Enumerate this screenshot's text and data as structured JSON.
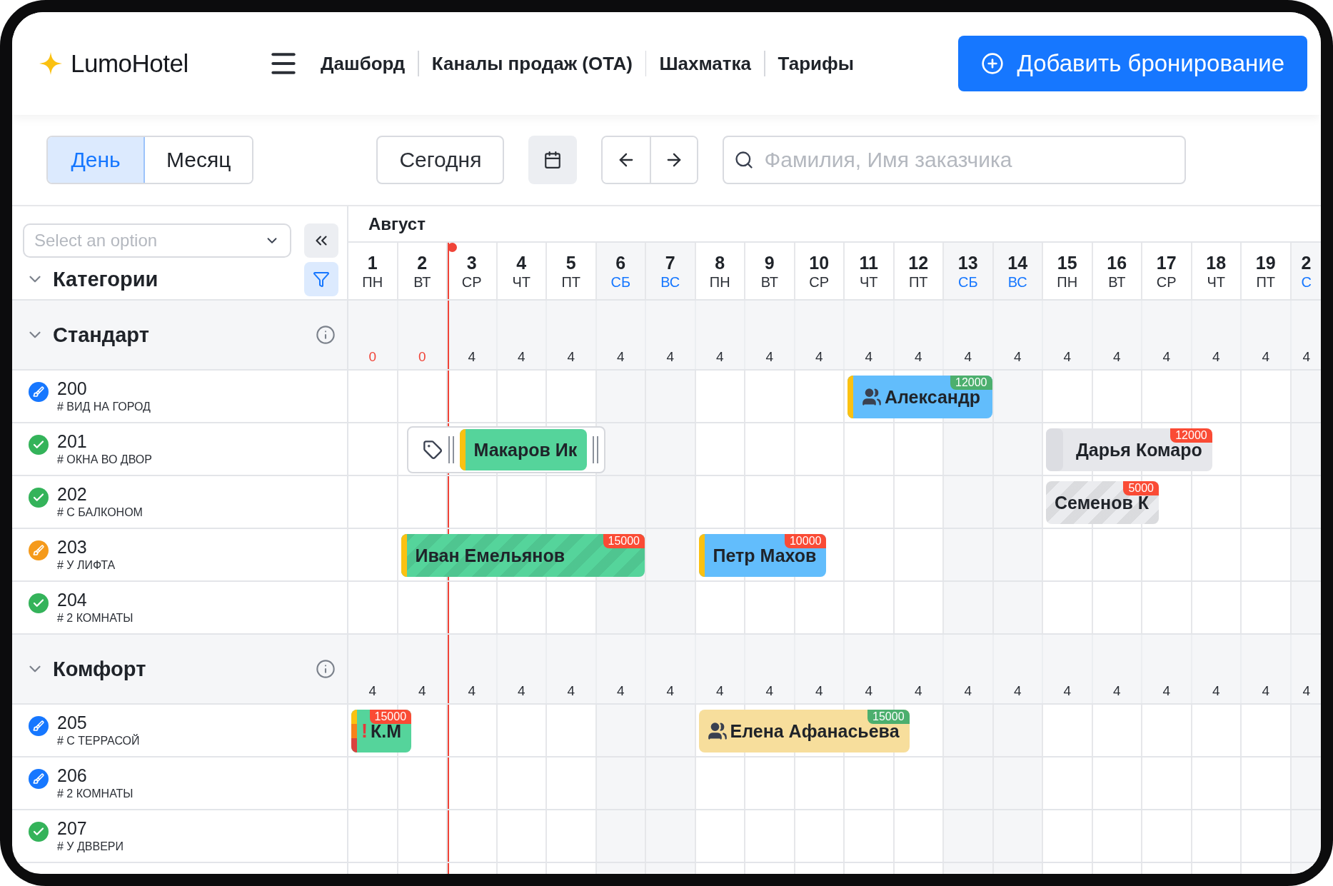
{
  "header": {
    "logo": "LumoHotel",
    "nav": [
      {
        "label": "Дашборд",
        "selected": false
      },
      {
        "label": "Каналы продаж (ОТА)",
        "selected": false
      },
      {
        "label": "Шахматка",
        "selected": false
      },
      {
        "label": "Тарифы",
        "selected": false
      }
    ],
    "add_button": "Добавить бронирование"
  },
  "toolbar": {
    "views": [
      {
        "label": "День",
        "selected": true
      },
      {
        "label": "Месяц",
        "selected": false
      }
    ],
    "today_button": "Сегодня",
    "search": {
      "placeholder": "Фамилия, Имя заказчика"
    }
  },
  "sidebar": {
    "select": {
      "placeholder": "Select an option"
    },
    "categories_title": "Категории",
    "categories_expanded": true
  },
  "calendar": {
    "month": "Август",
    "days": [
      {
        "num": "1",
        "name": "ПН",
        "weekend": false,
        "today": false
      },
      {
        "num": "2",
        "name": "ВТ",
        "weekend": false,
        "today": false
      },
      {
        "num": "3",
        "name": "СР",
        "weekend": false,
        "today": true
      },
      {
        "num": "4",
        "name": "ЧТ",
        "weekend": false,
        "today": false
      },
      {
        "num": "5",
        "name": "ПТ",
        "weekend": false,
        "today": false
      },
      {
        "num": "6",
        "name": "СБ",
        "weekend": true,
        "today": false
      },
      {
        "num": "7",
        "name": "ВС",
        "weekend": true,
        "today": false
      },
      {
        "num": "8",
        "name": "ПН",
        "weekend": false,
        "today": false
      },
      {
        "num": "9",
        "name": "ВТ",
        "weekend": false,
        "today": false
      },
      {
        "num": "10",
        "name": "СР",
        "weekend": false,
        "today": false
      },
      {
        "num": "11",
        "name": "ЧТ",
        "weekend": false,
        "today": false
      },
      {
        "num": "12",
        "name": "ПТ",
        "weekend": false,
        "today": false
      },
      {
        "num": "13",
        "name": "СБ",
        "weekend": true,
        "today": false
      },
      {
        "num": "14",
        "name": "ВС",
        "weekend": true,
        "today": false
      },
      {
        "num": "15",
        "name": "ПН",
        "weekend": false,
        "today": false
      },
      {
        "num": "16",
        "name": "ВТ",
        "weekend": false,
        "today": false
      },
      {
        "num": "17",
        "name": "СР",
        "weekend": false,
        "today": false
      },
      {
        "num": "18",
        "name": "ЧТ",
        "weekend": false,
        "today": false
      },
      {
        "num": "19",
        "name": "ПТ",
        "weekend": false,
        "today": false
      },
      {
        "num": "2",
        "name": "С",
        "weekend": true,
        "today": false
      }
    ]
  },
  "categories": [
    {
      "name": "Стандарт",
      "expanded": true,
      "counts": [
        {
          "value": "0",
          "sold_out": true
        },
        {
          "value": "0",
          "sold_out": true
        },
        {
          "value": "4",
          "sold_out": false
        },
        {
          "value": "4",
          "sold_out": false
        },
        {
          "value": "4",
          "sold_out": false
        },
        {
          "value": "4",
          "sold_out": false
        },
        {
          "value": "4",
          "sold_out": false
        },
        {
          "value": "4",
          "sold_out": false
        },
        {
          "value": "4",
          "sold_out": false
        },
        {
          "value": "4",
          "sold_out": false
        },
        {
          "value": "4",
          "sold_out": false
        },
        {
          "value": "4",
          "sold_out": false
        },
        {
          "value": "4",
          "sold_out": false
        },
        {
          "value": "4",
          "sold_out": false
        },
        {
          "value": "4",
          "sold_out": false
        },
        {
          "value": "4",
          "sold_out": false
        },
        {
          "value": "4",
          "sold_out": false
        },
        {
          "value": "4",
          "sold_out": false
        },
        {
          "value": "4",
          "sold_out": false
        },
        {
          "value": "4",
          "sold_out": false
        }
      ],
      "rooms": [
        {
          "number": "200",
          "tag": "# ВИД НА ГОРОД",
          "kind": "cleaning",
          "bookings": [
            {
              "guest": "Александр",
              "kind": "marked",
              "color": "#62bdfc",
              "striped": false,
              "group": true,
              "selected": false,
              "badge": {
                "text": "12000",
                "color": "#4caf6e"
              }
            }
          ]
        },
        {
          "number": "201",
          "tag": "# ОКНА ВО ДВОР",
          "kind": "clean",
          "bookings": [
            {
              "guest": "Макаров Ик",
              "kind": "marked",
              "color": "#55d49b",
              "striped": false,
              "group": false,
              "selected": true
            },
            {
              "guest": "Дарья Комаро",
              "kind": "split",
              "color": "#e6e7eb",
              "striped": false,
              "group": false,
              "selected": false,
              "badge": {
                "text": "12000",
                "color": "#fa4b35"
              }
            }
          ]
        },
        {
          "number": "202",
          "tag": "# С БАЛКОНОМ",
          "kind": "clean",
          "bookings": [
            {
              "guest": "Семенов К",
              "kind": "plain",
              "color": "#ebecef",
              "striped": true,
              "group": false,
              "selected": false,
              "badge": {
                "text": "5000",
                "color": "#fa4b35"
              }
            }
          ]
        },
        {
          "number": "203",
          "tag": "# У ЛИФТА",
          "kind": "dirty",
          "bookings": [
            {
              "guest": "Иван Емельянов",
              "kind": "marked",
              "color": "#55d49b",
              "striped": true,
              "group": false,
              "selected": false,
              "badge": {
                "text": "15000",
                "color": "#fa4b35"
              }
            },
            {
              "guest": "Петр Махов",
              "kind": "marked",
              "color": "#62bdfc",
              "striped": false,
              "group": false,
              "selected": false,
              "badge": {
                "text": "10000",
                "color": "#fa4b35"
              }
            }
          ]
        },
        {
          "number": "204",
          "tag": "# 2 КОМНАТЫ",
          "kind": "clean"
        }
      ]
    },
    {
      "name": "Комфорт",
      "expanded": true,
      "counts": [
        {
          "value": "4",
          "sold_out": false
        },
        {
          "value": "4",
          "sold_out": false
        },
        {
          "value": "4",
          "sold_out": false
        },
        {
          "value": "4",
          "sold_out": false
        },
        {
          "value": "4",
          "sold_out": false
        },
        {
          "value": "4",
          "sold_out": false
        },
        {
          "value": "4",
          "sold_out": false
        },
        {
          "value": "4",
          "sold_out": false
        },
        {
          "value": "4",
          "sold_out": false
        },
        {
          "value": "4",
          "sold_out": false
        },
        {
          "value": "4",
          "sold_out": false
        },
        {
          "value": "4",
          "sold_out": false
        },
        {
          "value": "4",
          "sold_out": false
        },
        {
          "value": "4",
          "sold_out": false
        },
        {
          "value": "4",
          "sold_out": false
        },
        {
          "value": "4",
          "sold_out": false
        },
        {
          "value": "4",
          "sold_out": false
        },
        {
          "value": "4",
          "sold_out": false
        },
        {
          "value": "4",
          "sold_out": false
        },
        {
          "value": "4",
          "sold_out": false
        }
      ],
      "rooms": [
        {
          "number": "205",
          "tag": "# С ТЕРРАСОЙ",
          "kind": "cleaning",
          "bookings": [
            {
              "guest": "К.М",
              "alert": "!",
              "kind": "warning",
              "color": "#55d49b",
              "striped": false,
              "group": false,
              "selected": false,
              "badge": {
                "text": "15000",
                "color": "#fa4b35"
              }
            },
            {
              "guest": "Елена Афанасьева",
              "kind": "plain",
              "color": "#f7de9c",
              "striped": false,
              "group": true,
              "selected": false,
              "badge": {
                "text": "15000",
                "color": "#4caf6e"
              }
            }
          ]
        },
        {
          "number": "206",
          "tag": "# 2 КОМНАТЫ",
          "kind": "cleaning"
        },
        {
          "number": "207",
          "tag": "# У ДВВЕРИ",
          "kind": "clean"
        }
      ]
    }
  ]
}
